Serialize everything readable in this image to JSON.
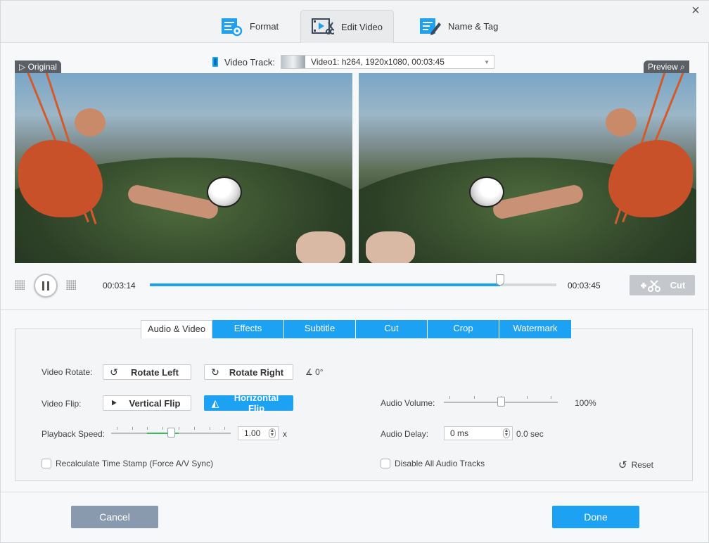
{
  "tabs": [
    {
      "label": "Format",
      "icon": "format-icon"
    },
    {
      "label": "Edit Video",
      "icon": "edit-video-icon"
    },
    {
      "label": "Name & Tag",
      "icon": "name-tag-icon"
    }
  ],
  "video_track": {
    "label": "Video Track:",
    "selected": "Video1: h264, 1920x1080, 00:03:45"
  },
  "panes": {
    "original_label": "Original",
    "preview_label": "Preview"
  },
  "player": {
    "current_time": "00:03:14",
    "total_time": "00:03:45",
    "progress": 0.862,
    "cut_label": "Cut"
  },
  "edit_tabs": [
    "Audio & Video",
    "Effects",
    "Subtitle",
    "Cut",
    "Crop",
    "Watermark"
  ],
  "settings": {
    "rotate_label": "Video Rotate:",
    "rotate_left": "Rotate Left",
    "rotate_right": "Rotate Right",
    "rotate_angle": "0°",
    "flip_label": "Video Flip:",
    "vertical_flip": "Vertical Flip",
    "horizontal_flip": "Horizontal Flip",
    "speed_label": "Playback Speed:",
    "speed_value": "1.00",
    "speed_unit": "x",
    "speed_level": 0.5,
    "volume_label": "Audio Volume:",
    "volume_value": "100%",
    "volume_level": 0.5,
    "delay_label": "Audio Delay:",
    "delay_value": "0 ms",
    "delay_sec": "0.0 sec",
    "recalc_label": "Recalculate Time Stamp (Force A/V Sync)",
    "disable_audio_label": "Disable All Audio Tracks",
    "reset_label": "Reset"
  },
  "footer": {
    "cancel": "Cancel",
    "done": "Done"
  },
  "colors": {
    "accent": "#1da1f2",
    "cancel_bg": "#8a9aae",
    "disabled": "#c4c8cc"
  }
}
